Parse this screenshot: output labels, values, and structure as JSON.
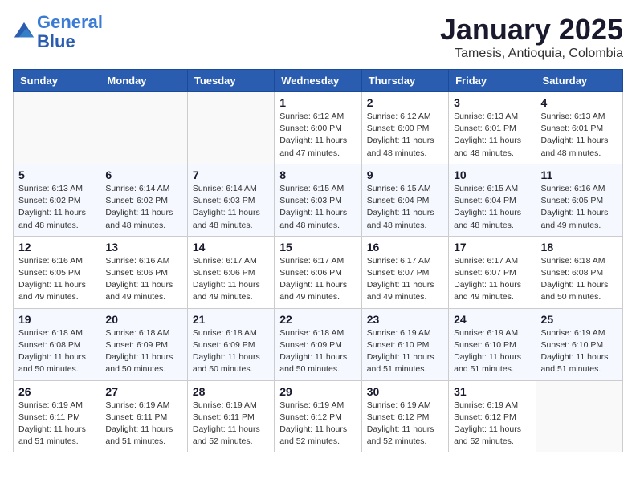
{
  "header": {
    "logo_line1": "General",
    "logo_line2": "Blue",
    "month": "January 2025",
    "location": "Tamesis, Antioquia, Colombia"
  },
  "weekdays": [
    "Sunday",
    "Monday",
    "Tuesday",
    "Wednesday",
    "Thursday",
    "Friday",
    "Saturday"
  ],
  "weeks": [
    [
      {
        "day": "",
        "info": ""
      },
      {
        "day": "",
        "info": ""
      },
      {
        "day": "",
        "info": ""
      },
      {
        "day": "1",
        "info": "Sunrise: 6:12 AM\nSunset: 6:00 PM\nDaylight: 11 hours\nand 47 minutes."
      },
      {
        "day": "2",
        "info": "Sunrise: 6:12 AM\nSunset: 6:00 PM\nDaylight: 11 hours\nand 48 minutes."
      },
      {
        "day": "3",
        "info": "Sunrise: 6:13 AM\nSunset: 6:01 PM\nDaylight: 11 hours\nand 48 minutes."
      },
      {
        "day": "4",
        "info": "Sunrise: 6:13 AM\nSunset: 6:01 PM\nDaylight: 11 hours\nand 48 minutes."
      }
    ],
    [
      {
        "day": "5",
        "info": "Sunrise: 6:13 AM\nSunset: 6:02 PM\nDaylight: 11 hours\nand 48 minutes."
      },
      {
        "day": "6",
        "info": "Sunrise: 6:14 AM\nSunset: 6:02 PM\nDaylight: 11 hours\nand 48 minutes."
      },
      {
        "day": "7",
        "info": "Sunrise: 6:14 AM\nSunset: 6:03 PM\nDaylight: 11 hours\nand 48 minutes."
      },
      {
        "day": "8",
        "info": "Sunrise: 6:15 AM\nSunset: 6:03 PM\nDaylight: 11 hours\nand 48 minutes."
      },
      {
        "day": "9",
        "info": "Sunrise: 6:15 AM\nSunset: 6:04 PM\nDaylight: 11 hours\nand 48 minutes."
      },
      {
        "day": "10",
        "info": "Sunrise: 6:15 AM\nSunset: 6:04 PM\nDaylight: 11 hours\nand 48 minutes."
      },
      {
        "day": "11",
        "info": "Sunrise: 6:16 AM\nSunset: 6:05 PM\nDaylight: 11 hours\nand 49 minutes."
      }
    ],
    [
      {
        "day": "12",
        "info": "Sunrise: 6:16 AM\nSunset: 6:05 PM\nDaylight: 11 hours\nand 49 minutes."
      },
      {
        "day": "13",
        "info": "Sunrise: 6:16 AM\nSunset: 6:06 PM\nDaylight: 11 hours\nand 49 minutes."
      },
      {
        "day": "14",
        "info": "Sunrise: 6:17 AM\nSunset: 6:06 PM\nDaylight: 11 hours\nand 49 minutes."
      },
      {
        "day": "15",
        "info": "Sunrise: 6:17 AM\nSunset: 6:06 PM\nDaylight: 11 hours\nand 49 minutes."
      },
      {
        "day": "16",
        "info": "Sunrise: 6:17 AM\nSunset: 6:07 PM\nDaylight: 11 hours\nand 49 minutes."
      },
      {
        "day": "17",
        "info": "Sunrise: 6:17 AM\nSunset: 6:07 PM\nDaylight: 11 hours\nand 49 minutes."
      },
      {
        "day": "18",
        "info": "Sunrise: 6:18 AM\nSunset: 6:08 PM\nDaylight: 11 hours\nand 50 minutes."
      }
    ],
    [
      {
        "day": "19",
        "info": "Sunrise: 6:18 AM\nSunset: 6:08 PM\nDaylight: 11 hours\nand 50 minutes."
      },
      {
        "day": "20",
        "info": "Sunrise: 6:18 AM\nSunset: 6:09 PM\nDaylight: 11 hours\nand 50 minutes."
      },
      {
        "day": "21",
        "info": "Sunrise: 6:18 AM\nSunset: 6:09 PM\nDaylight: 11 hours\nand 50 minutes."
      },
      {
        "day": "22",
        "info": "Sunrise: 6:18 AM\nSunset: 6:09 PM\nDaylight: 11 hours\nand 50 minutes."
      },
      {
        "day": "23",
        "info": "Sunrise: 6:19 AM\nSunset: 6:10 PM\nDaylight: 11 hours\nand 51 minutes."
      },
      {
        "day": "24",
        "info": "Sunrise: 6:19 AM\nSunset: 6:10 PM\nDaylight: 11 hours\nand 51 minutes."
      },
      {
        "day": "25",
        "info": "Sunrise: 6:19 AM\nSunset: 6:10 PM\nDaylight: 11 hours\nand 51 minutes."
      }
    ],
    [
      {
        "day": "26",
        "info": "Sunrise: 6:19 AM\nSunset: 6:11 PM\nDaylight: 11 hours\nand 51 minutes."
      },
      {
        "day": "27",
        "info": "Sunrise: 6:19 AM\nSunset: 6:11 PM\nDaylight: 11 hours\nand 51 minutes."
      },
      {
        "day": "28",
        "info": "Sunrise: 6:19 AM\nSunset: 6:11 PM\nDaylight: 11 hours\nand 52 minutes."
      },
      {
        "day": "29",
        "info": "Sunrise: 6:19 AM\nSunset: 6:12 PM\nDaylight: 11 hours\nand 52 minutes."
      },
      {
        "day": "30",
        "info": "Sunrise: 6:19 AM\nSunset: 6:12 PM\nDaylight: 11 hours\nand 52 minutes."
      },
      {
        "day": "31",
        "info": "Sunrise: 6:19 AM\nSunset: 6:12 PM\nDaylight: 11 hours\nand 52 minutes."
      },
      {
        "day": "",
        "info": ""
      }
    ]
  ]
}
